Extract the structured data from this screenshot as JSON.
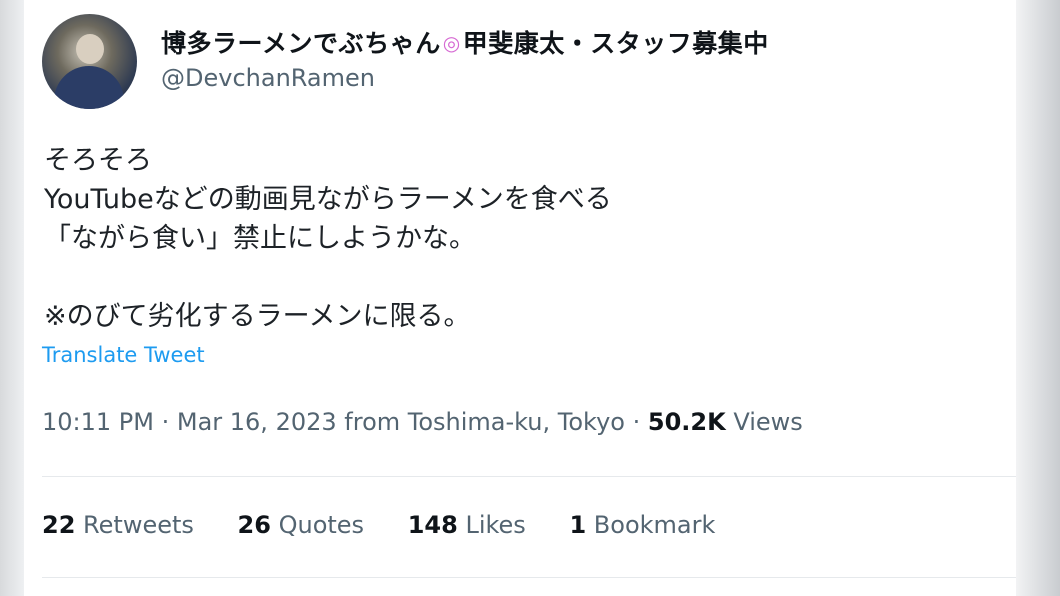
{
  "author": {
    "display_name_part1": "博多ラーメンでぶちゃん",
    "name_icon": "swirl-emoji-icon",
    "display_name_part2": "甲斐康太・スタッフ募集中",
    "handle": "@DevchanRamen"
  },
  "tweet": {
    "text": "そろそろ\nYouTubeなどの動画見ながらラーメンを食べる\n「ながら食い」禁止にしようかな。\n\n※のびて劣化するラーメンに限る。",
    "translate_label": "Translate Tweet",
    "timestamp": "10:11 PM · Mar 16, 2023 from Toshima-ku, Tokyo ·",
    "views_count": "50.2K",
    "views_label": "Views"
  },
  "stats": {
    "retweets_count": "22",
    "retweets_label": "Retweets",
    "quotes_count": "26",
    "quotes_label": "Quotes",
    "likes_count": "148",
    "likes_label": "Likes",
    "bookmarks_count": "1",
    "bookmarks_label": "Bookmark"
  },
  "colors": {
    "link": "#1d9bf0",
    "secondary_text": "#536471",
    "primary_text": "#0f1419"
  }
}
